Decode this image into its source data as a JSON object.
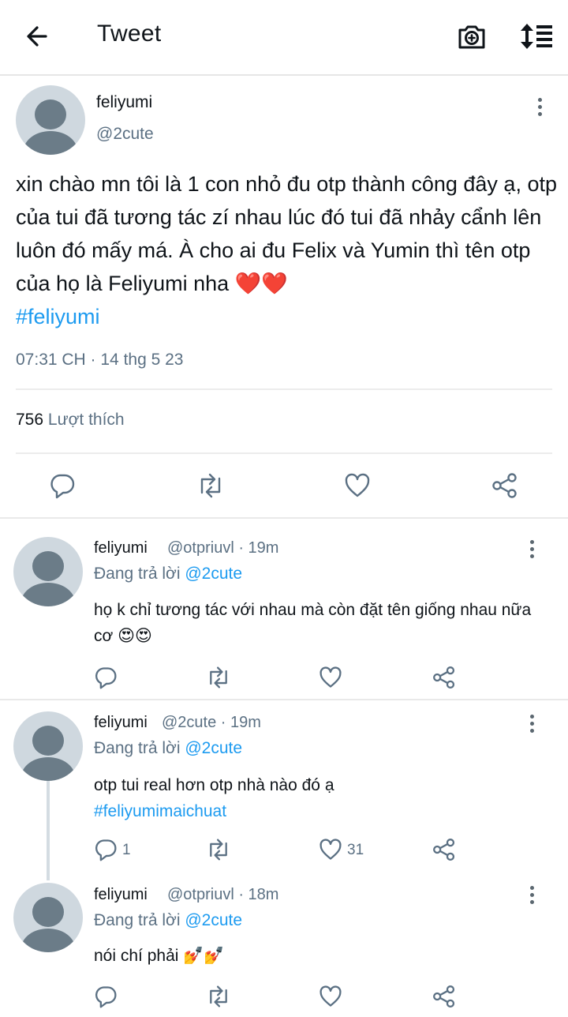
{
  "header": {
    "title": "Tweet"
  },
  "main_tweet": {
    "name": "feliyumi",
    "handle": "@2cute",
    "text": "xin chào mn tôi là 1 con nhỏ đu otp thành công đây ạ, otp của tui đã tương tác zí nhau lúc đó tui đã nhảy cẩnh lên luôn đó mấy má.  À cho ai đu Felix và Yumin thì tên otp của họ là Feliyumi nha ❤️❤️",
    "hashtag": "#feliyumi",
    "timestamp": "07:31 CH · 14 thg 5 23",
    "likes_count": "756",
    "likes_label": "Lượt thích"
  },
  "replies": [
    {
      "name": "feliyumi",
      "handle": "@otpriuvl",
      "time": "· 19m",
      "reply_prefix": "Đang trả lời",
      "reply_to": "@2cute",
      "text": "họ k chỉ tương tác với nhau mà còn đặt tên giống nhau nữa cơ 😍😍",
      "reply_count": "",
      "like_count": ""
    },
    {
      "name": "feliyumi",
      "handle": "@2cute",
      "time": "· 19m",
      "reply_prefix": "Đang trả lời",
      "reply_to": "@2cute",
      "text": "otp tui real hơn otp nhà nào đó ạ",
      "hashtag": "#feliyumimaichuat",
      "reply_count": "1",
      "like_count": "31"
    },
    {
      "name": "feliyumi",
      "handle": "@otpriuvl",
      "time": "· 18m",
      "reply_prefix": "Đang trả lời",
      "reply_to": "@2cute",
      "text": "nói chí phải 💅💅",
      "reply_count": "",
      "like_count": ""
    }
  ],
  "icons": {
    "back": "arrow-left-icon",
    "camera": "camera-plus-icon",
    "sort": "sort-icon",
    "reply": "reply-icon",
    "retweet": "retweet-icon",
    "like": "heart-icon",
    "share": "share-icon"
  },
  "colors": {
    "link": "#1d9bf0",
    "secondary": "#5b7083",
    "avatar_bg": "#cfd8df",
    "avatar_fg": "#6b7c88"
  }
}
